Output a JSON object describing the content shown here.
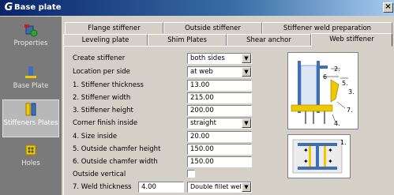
{
  "window": {
    "title": "Base plate",
    "logo": "G"
  },
  "sidebar": {
    "items": [
      {
        "label": "Properties",
        "icon": "properties-icon"
      },
      {
        "label": "Base Plate",
        "icon": "base-plate-icon"
      },
      {
        "label": "Stiffeners Plates",
        "icon": "stiffener-icon",
        "active": true
      },
      {
        "label": "Holes",
        "icon": "holes-icon"
      }
    ]
  },
  "tabs_row1": [
    "Flange stiffener",
    "Outside stiffener",
    "Stiffener weld preparation"
  ],
  "tabs_row2": [
    "Leveling plate",
    "Shim Plates",
    "Shear anchor",
    "Web stiffener"
  ],
  "selected_tab": "Web stiffener",
  "form": {
    "create_stiffener": {
      "label": "Create stiffener",
      "value": "both sides"
    },
    "location_per_side": {
      "label": "Location per side",
      "value": "at web"
    },
    "stiffener_thickness": {
      "label": "1. Stiffener thickness",
      "value": "13.00"
    },
    "stiffener_width": {
      "label": "2. Stiffener width",
      "value": "215.00"
    },
    "stiffener_height": {
      "label": "3. Stiffener height",
      "value": "200.00"
    },
    "corner_finish_inside": {
      "label": "Corner finish inside",
      "value": "straight"
    },
    "size_inside": {
      "label": "4. Size inside",
      "value": "20.00"
    },
    "outside_chamfer_height": {
      "label": "5. Outside chamfer height",
      "value": "150.00"
    },
    "outside_chamfer_width": {
      "label": "6. Outside chamfer width",
      "value": "150.00"
    },
    "outside_vertical": {
      "label": "Outside vertical",
      "checked": false
    },
    "weld_thickness": {
      "label": "7. Weld thickness",
      "value": "4.00",
      "type_value": "Double fillet weld"
    }
  },
  "diagram": {
    "side_labels": [
      "2.",
      "6",
      "5.",
      "3.",
      "7.",
      "4."
    ],
    "plan_label": "1."
  },
  "colors": {
    "accent": "#0a246a",
    "stiffener": "#f0c800",
    "steel": "#3f6fb7"
  }
}
